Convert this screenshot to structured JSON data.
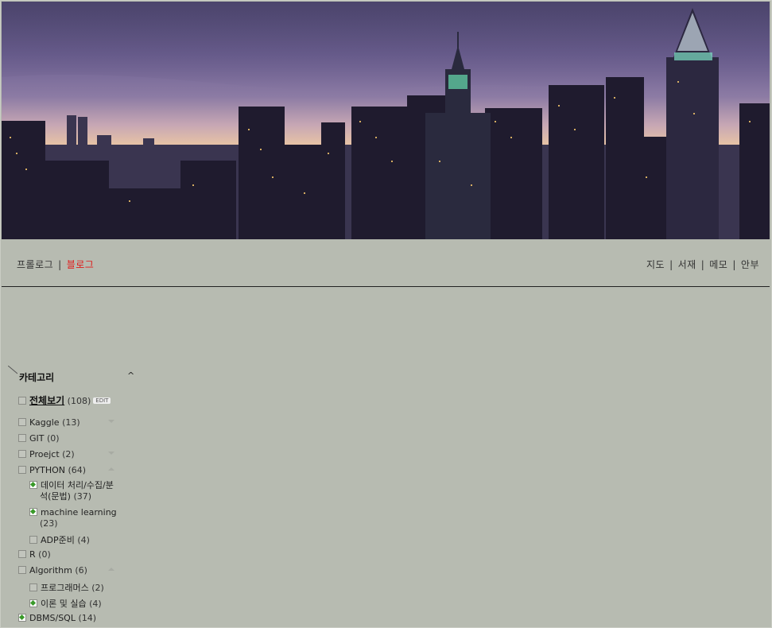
{
  "nav": {
    "left": [
      "프롤로그",
      "블로그"
    ],
    "right": [
      "지도",
      "서재",
      "메모",
      "안부"
    ]
  },
  "category": {
    "title": "카테고리",
    "all_label": "전체보기",
    "all_count": "(108)",
    "edit_label": "EDIT",
    "items": [
      {
        "label": "Kaggle",
        "count": "(13)"
      },
      {
        "label": "GIT",
        "count": "(0)"
      },
      {
        "label": "Proejct",
        "count": "(2)"
      },
      {
        "label": "PYTHON",
        "count": "(64)"
      },
      {
        "label": "데이터 처리/수집/분",
        "label2": "석(문법)",
        "count": "(37)"
      },
      {
        "label": "machine learning",
        "count": "(23)"
      },
      {
        "label": "ADP준비",
        "count": "(4)"
      },
      {
        "label": "R",
        "count": "(0)"
      },
      {
        "label": "Algorithm",
        "count": "(6)"
      },
      {
        "label": "프로그래머스",
        "count": "(2)"
      },
      {
        "label": "이론 및 실습",
        "count": "(4)"
      },
      {
        "label": "DBMS/SQL",
        "count": "(14)"
      }
    ]
  },
  "colors": {
    "active_nav": "#e01818",
    "background": "#b7bbb1"
  }
}
